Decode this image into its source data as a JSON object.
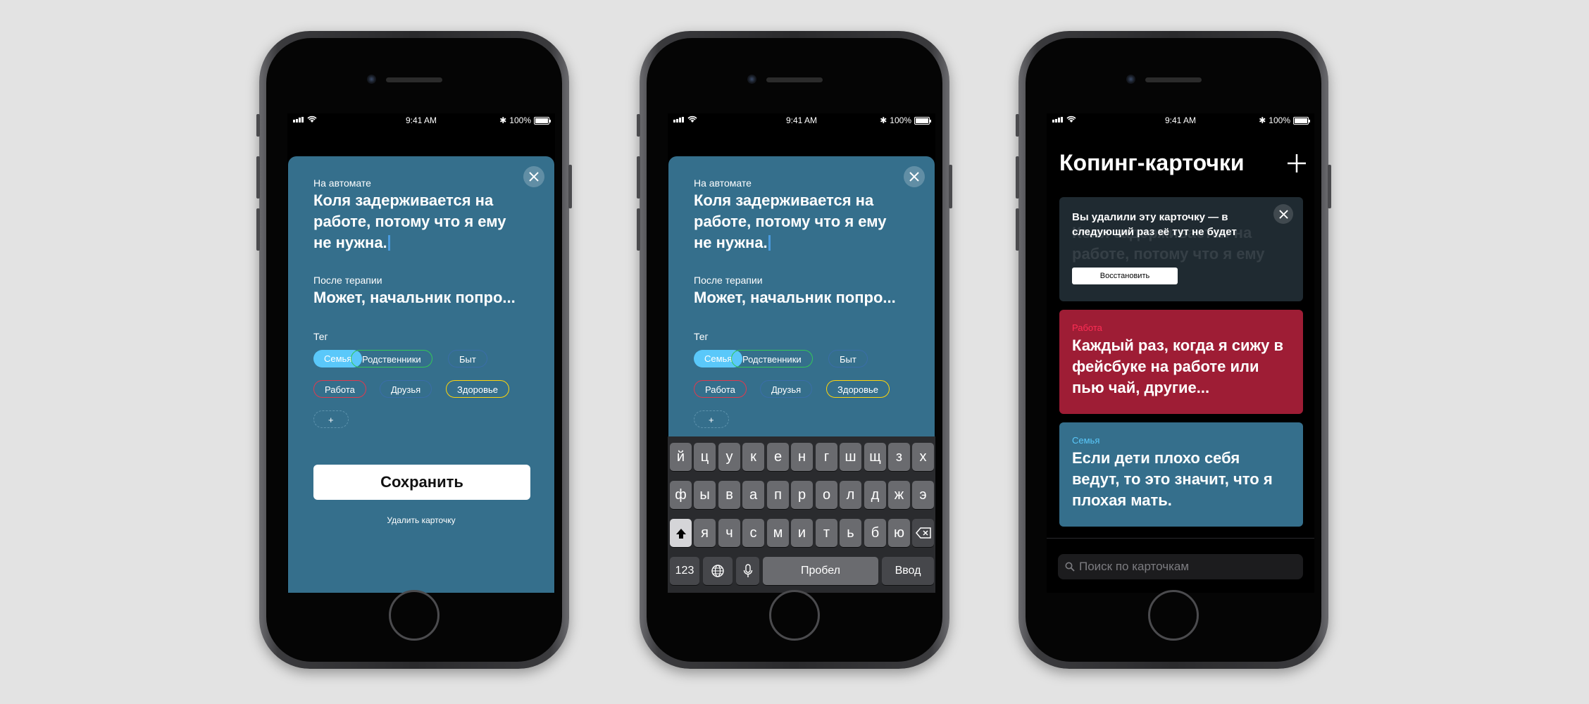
{
  "status_bar": {
    "time": "9:41 AM",
    "battery": "100%"
  },
  "edit_sheet": {
    "auto_label": "На автомате",
    "auto_thought": "Коля задерживается на работе, потому что я ему не нужна.",
    "after_label": "После терапии",
    "after_thought": "Может, начальник попро...",
    "tag_label": "Тег",
    "tags": [
      {
        "label": "Семья",
        "selected": true,
        "color": "#5ac8fa"
      },
      {
        "label": "Родственники",
        "selected": false,
        "color": "#34c759"
      },
      {
        "label": "Быт",
        "selected": false,
        "color": "#3a6ea8"
      },
      {
        "label": "Работа",
        "selected": false,
        "color": "#e03a4e"
      },
      {
        "label": "Друзья",
        "selected": false,
        "color": "#3a6ea8"
      },
      {
        "label": "Здоровье",
        "selected": false,
        "color": "#ffd60a"
      }
    ],
    "add_tag": "+",
    "save_label": "Сохранить",
    "delete_label": "Удалить карточку"
  },
  "keyboard": {
    "row1": [
      "й",
      "ц",
      "у",
      "к",
      "е",
      "н",
      "г",
      "ш",
      "щ",
      "з",
      "х"
    ],
    "row2": [
      "ф",
      "ы",
      "в",
      "а",
      "п",
      "р",
      "о",
      "л",
      "д",
      "ж",
      "э"
    ],
    "row3": [
      "я",
      "ч",
      "с",
      "м",
      "и",
      "т",
      "ь",
      "б",
      "ю"
    ],
    "numbers_label": "123",
    "space_label": "Пробел",
    "return_label": "Ввод"
  },
  "cards_screen": {
    "title": "Копинг-карточки",
    "deleted_notice": {
      "text": "Вы удалили эту карточку — в следующий раз её тут не будет",
      "ghost_text": "Коля задерживается на работе, потому что я ему",
      "restore_label": "Восстановить"
    },
    "cards": [
      {
        "tag": "Работа",
        "text": "Каждый раз, когда я сижу в фейсбуке на работе или пью чай, другие...",
        "bg": "#9e1d35",
        "tag_color": "#ff2d55"
      },
      {
        "tag": "Семья",
        "text": "Если дети плохо себя ведут, то это значит, что я плохая мать.",
        "bg": "#356f8c",
        "tag_color": "#5ac8fa"
      }
    ],
    "search_placeholder": "Поиск по карточкам"
  }
}
